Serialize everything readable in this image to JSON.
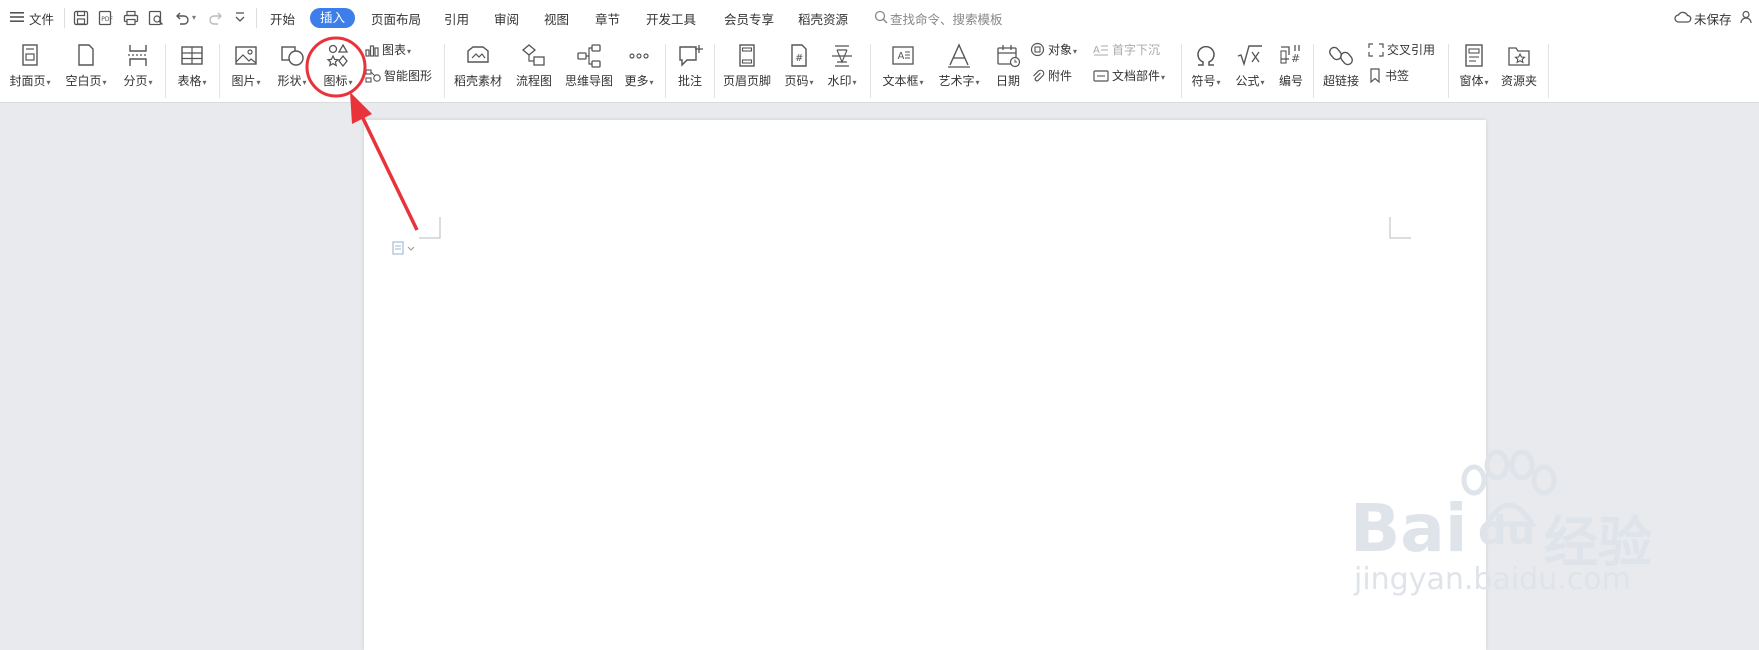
{
  "toolbar": {
    "file_menu": "文件",
    "tabs": [
      "开始",
      "插入",
      "页面布局",
      "引用",
      "审阅",
      "视图",
      "章节",
      "开发工具",
      "会员专享",
      "稻壳资源"
    ],
    "active_tab": "插入",
    "search_placeholder": "查找命令、搜索模板",
    "unsaved": "未保存"
  },
  "ribbon": {
    "cover": "封面页",
    "blank": "空白页",
    "break": "分页",
    "table": "表格",
    "picture": "图片",
    "shape": "形状",
    "icon": "图标",
    "chart": "图表",
    "smartart": "智能图形",
    "daoke": "稻壳素材",
    "flow": "流程图",
    "mind": "思维导图",
    "more": "更多",
    "comment": "批注",
    "header_footer": "页眉页脚",
    "page_num": "页码",
    "watermark": "水印",
    "textbox": "文本框",
    "wordart": "艺术字",
    "date": "日期",
    "object": "对象",
    "dropcap": "首字下沉",
    "attachment": "附件",
    "doc_parts": "文档部件",
    "symbol": "符号",
    "formula": "公式",
    "numbering": "编号",
    "hyperlink": "超链接",
    "crossref": "交叉引用",
    "bookmark": "书签",
    "form": "窗体",
    "resources": "资源夹"
  },
  "watermark": {
    "brand_a": "Bai",
    "brand_b": "du",
    "brand_cn": "经验",
    "url": "jingyan.baidu.com"
  },
  "colors": {
    "accent": "#3c7eea",
    "annotation": "#e8333a",
    "page_bg": "#e9eaed"
  }
}
